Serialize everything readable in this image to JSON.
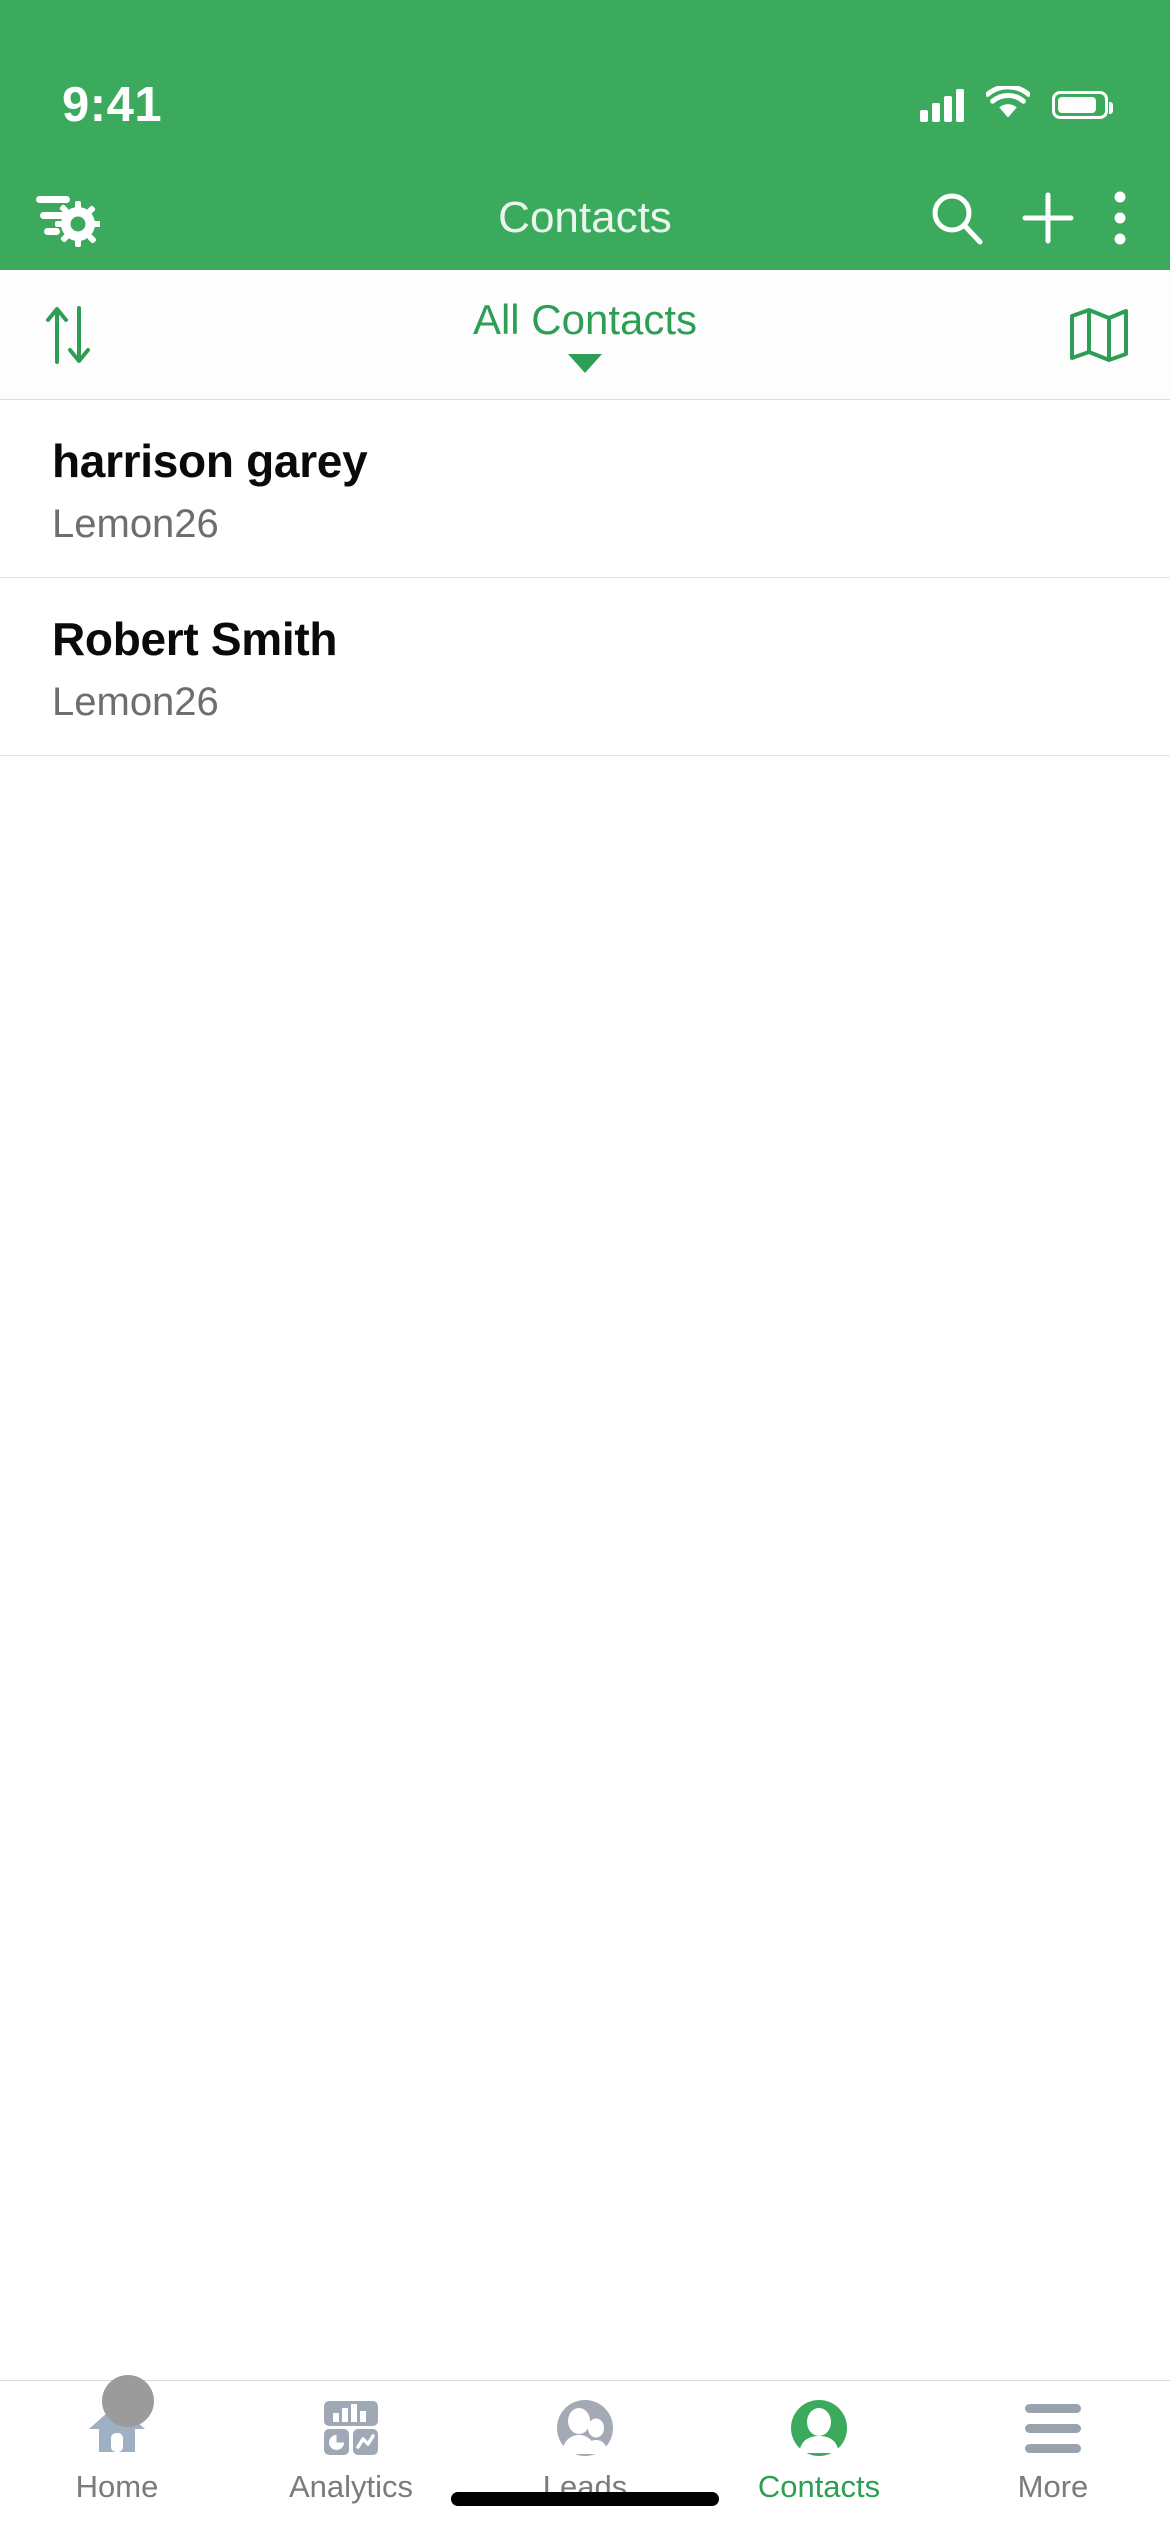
{
  "theme": {
    "brand": "#3BAA5D",
    "brand_dark": "#2E9E54",
    "inactive_gray": "#9AA3AD",
    "label_gray": "#7B7B7B"
  },
  "status_bar": {
    "time": "9:41",
    "signal_icon": "cellular-signal-icon",
    "wifi_icon": "wifi-icon",
    "battery_icon": "battery-icon"
  },
  "app_bar": {
    "title": "Contacts",
    "filter_settings_icon": "filter-settings-icon",
    "search_icon": "search-icon",
    "add_icon": "plus-icon",
    "overflow_icon": "overflow-menu-icon"
  },
  "filter_bar": {
    "sort_icon": "sort-arrows-icon",
    "selected_view": "All Contacts",
    "dropdown_icon": "chevron-down-icon",
    "map_icon": "map-icon"
  },
  "contacts": [
    {
      "name": "harrison garey",
      "subtitle": "Lemon26"
    },
    {
      "name": "Robert Smith",
      "subtitle": "Lemon26"
    }
  ],
  "tab_bar": {
    "items": [
      {
        "label": "Home",
        "icon": "home-icon",
        "active": false,
        "badge": true
      },
      {
        "label": "Analytics",
        "icon": "analytics-icon",
        "active": false,
        "badge": false
      },
      {
        "label": "Leads",
        "icon": "leads-icon",
        "active": false,
        "badge": false
      },
      {
        "label": "Contacts",
        "icon": "contacts-icon",
        "active": true,
        "badge": false
      },
      {
        "label": "More",
        "icon": "more-menu-icon",
        "active": false,
        "badge": false
      }
    ]
  }
}
